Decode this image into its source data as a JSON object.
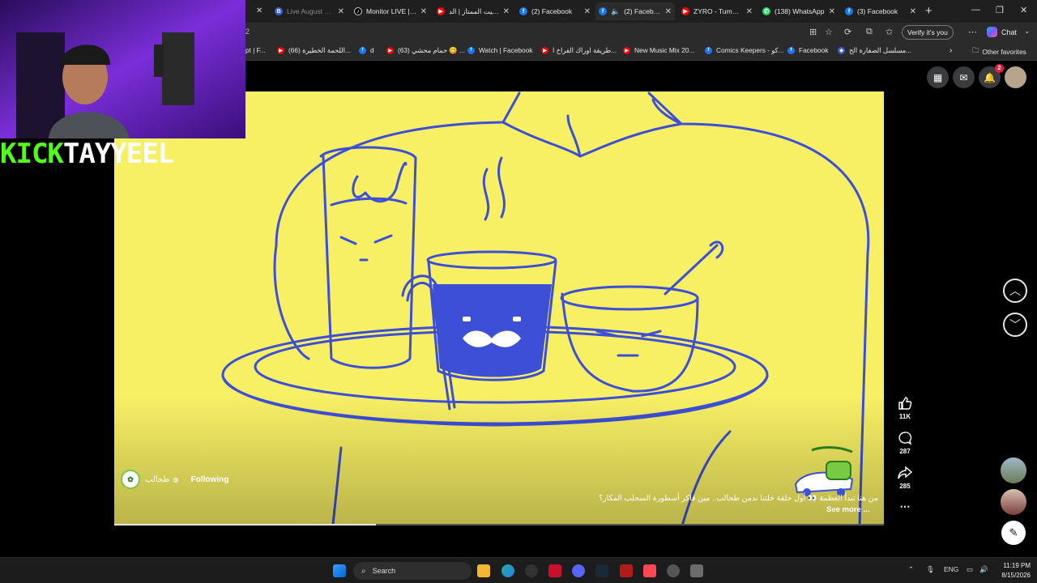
{
  "browser": {
    "tabs": [
      {
        "title": "Live August 08 -",
        "icon": "bl",
        "dim": true
      },
      {
        "title": "Monitor LIVE | Tik",
        "icon": "tt"
      },
      {
        "title": "السيت الممتاز | الد",
        "icon": "yt"
      },
      {
        "title": "(2) Facebook",
        "icon": "fb"
      },
      {
        "title": "(2) Facebook",
        "icon": "fb",
        "active": true,
        "muted": true
      },
      {
        "title": "ZYRO - Tuma Nu",
        "icon": "yt"
      },
      {
        "title": "(138) WhatsApp",
        "icon": "wa"
      },
      {
        "title": "(3) Facebook",
        "icon": "fb"
      }
    ],
    "address_fragment": "2",
    "verify_label": "Verify it's you",
    "copilot_label": "Chat",
    "favorites": [
      {
        "label": "pt | F...",
        "icon": ""
      },
      {
        "label": "(66) اللحمة الخطيرة...",
        "icon": "yt"
      },
      {
        "label": "d",
        "icon": "fb"
      },
      {
        "label": "(63) حمام محشي 😋 ...",
        "icon": "yt"
      },
      {
        "label": "Watch | Facebook",
        "icon": "fb"
      },
      {
        "label": "طريقة اوراك الفراخ ا...",
        "icon": "yt"
      },
      {
        "label": "New Music Mix 20...",
        "icon": "yt"
      },
      {
        "label": "Comics Keepers - كو...",
        "icon": "fb"
      },
      {
        "label": "Facebook",
        "icon": "fb"
      },
      {
        "label": "مسلسل الصفارة الح...",
        "icon": "bl"
      }
    ],
    "other_favorites": "Other favorites"
  },
  "overlay": {
    "kick_a": "KICK",
    "kick_b": "TAYYEEL"
  },
  "reel": {
    "channel_name": "طحالب",
    "following_label": "Following",
    "caption": "من هنا تبدأ العظمة 👀 أول حلقة خلتنا ندمن طحالب.. مين فاكر أسطورة السحلب المكار؟",
    "see_more": "See more ...",
    "likes": "11K",
    "comments": "287",
    "shares": "285",
    "progress_fraction": 0.34,
    "brand_green": "#7ac943",
    "drawing_blue": "#3d4fd6",
    "bg_yellow": "#f7ef64"
  },
  "fb_header": {
    "notif_count": "2"
  },
  "taskbar": {
    "search_placeholder": "Search",
    "lang": "ENG",
    "time": "11:19 PM",
    "date": "8/15/2026"
  }
}
